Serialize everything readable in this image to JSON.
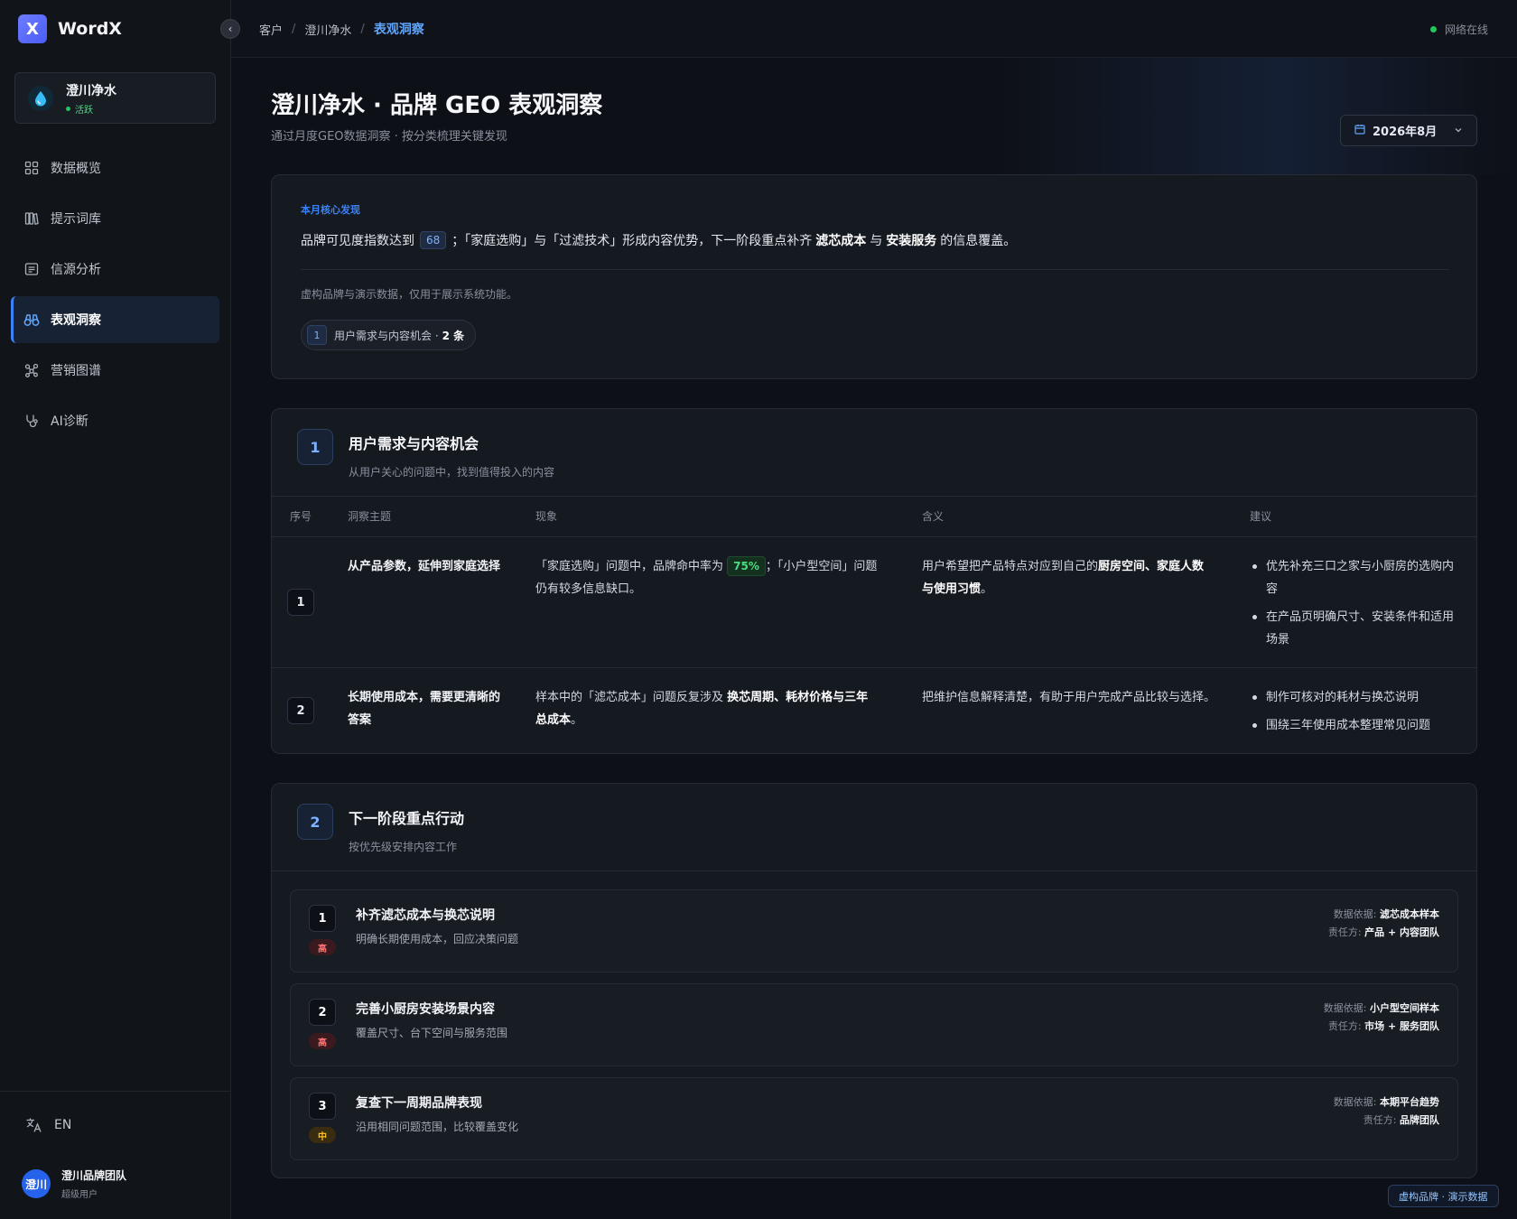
{
  "app": {
    "logo_letter": "X",
    "name": "WordX"
  },
  "brand": {
    "name": "澄川净水",
    "status": "活跃"
  },
  "nav": [
    {
      "label": "数据概览",
      "icon": "grid-icon"
    },
    {
      "label": "提示词库",
      "icon": "library-icon"
    },
    {
      "label": "信源分析",
      "icon": "list-icon"
    },
    {
      "label": "表观洞察",
      "icon": "binoculars-icon",
      "active": true
    },
    {
      "label": "营销图谱",
      "icon": "graph-icon"
    },
    {
      "label": "AI诊断",
      "icon": "stethoscope-icon"
    }
  ],
  "lang": "EN",
  "user": {
    "avatar": "澄川",
    "name": "澄川品牌团队",
    "role": "超级用户"
  },
  "breadcrumb": [
    "客户",
    "澄川净水",
    "表观洞察"
  ],
  "net_status": "网络在线",
  "page": {
    "title": "澄川净水 · 品牌 GEO 表观洞察",
    "subtitle": "通过月度GEO数据洞察 · 按分类梳理关键发现",
    "date": "2026年8月"
  },
  "highlight": {
    "label": "本月核心发现",
    "t1": "品牌可见度指数达到",
    "score": "68",
    "t2": "；「家庭选购」与「过滤技术」形成内容优势，下一阶段重点补齐",
    "b1": "滤芯成本",
    "t3": "与",
    "b2": "安装服务",
    "t4": "的信息覆盖。",
    "note": "虚构品牌与演示数据，仅用于展示系统功能。",
    "chip_num": "1",
    "chip_text": "用户需求与内容机会 ·",
    "chip_count": "2 条"
  },
  "section1": {
    "num": "1",
    "title": "用户需求与内容机会",
    "subtitle": "从用户关心的问题中，找到值得投入的内容",
    "headers": [
      "序号",
      "洞察主题",
      "现象",
      "含义",
      "建议"
    ],
    "rows": [
      {
        "num": "1",
        "topic": "从产品参数，延伸到家庭选择",
        "ph_a": "「家庭选购」问题中，品牌命中率为",
        "ph_pct": "75%",
        "ph_b": "；「小户型空间」问题仍有较多信息缺口。",
        "mean_a": "用户希望把产品特点对应到自己的",
        "mean_b": "厨房空间、家庭人数与使用习惯",
        "mean_c": "。",
        "sug": [
          "优先补充三口之家与小厨房的选购内容",
          "在产品页明确尺寸、安装条件和适用场景"
        ]
      },
      {
        "num": "2",
        "topic": "长期使用成本，需要更清晰的答案",
        "ph_a": "样本中的「滤芯成本」问题反复涉及",
        "ph_b": "换芯周期、耗材价格与三年总成本",
        "ph_c": "。",
        "mean": "把维护信息解释清楚，有助于用户完成产品比较与选择。",
        "sug": [
          "制作可核对的耗材与换芯说明",
          "围绕三年使用成本整理常见问题"
        ]
      }
    ]
  },
  "section2": {
    "num": "2",
    "title": "下一阶段重点行动",
    "subtitle": "按优先级安排内容工作",
    "basis_label": "数据依据:",
    "owner_label": "责任方:",
    "actions": [
      {
        "num": "1",
        "priority": "高",
        "title": "补齐滤芯成本与换芯说明",
        "desc": "明确长期使用成本，回应决策问题",
        "basis": "滤芯成本样本",
        "owner": "产品 + 内容团队"
      },
      {
        "num": "2",
        "priority": "高",
        "title": "完善小厨房安装场景内容",
        "desc": "覆盖尺寸、台下空间与服务范围",
        "basis": "小户型空间样本",
        "owner": "市场 + 服务团队"
      },
      {
        "num": "3",
        "priority": "中",
        "title": "复查下一周期品牌表现",
        "desc": "沿用相同问题范围，比较覆盖变化",
        "basis": "本期平台趋势",
        "owner": "品牌团队"
      }
    ]
  },
  "demo_tag": "虚构品牌 · 演示数据",
  "colors": {
    "accent": "#3b82f6",
    "bg": "#0d1016",
    "success": "#22c55e",
    "high": "#f87171",
    "mid": "#fbbf24"
  }
}
